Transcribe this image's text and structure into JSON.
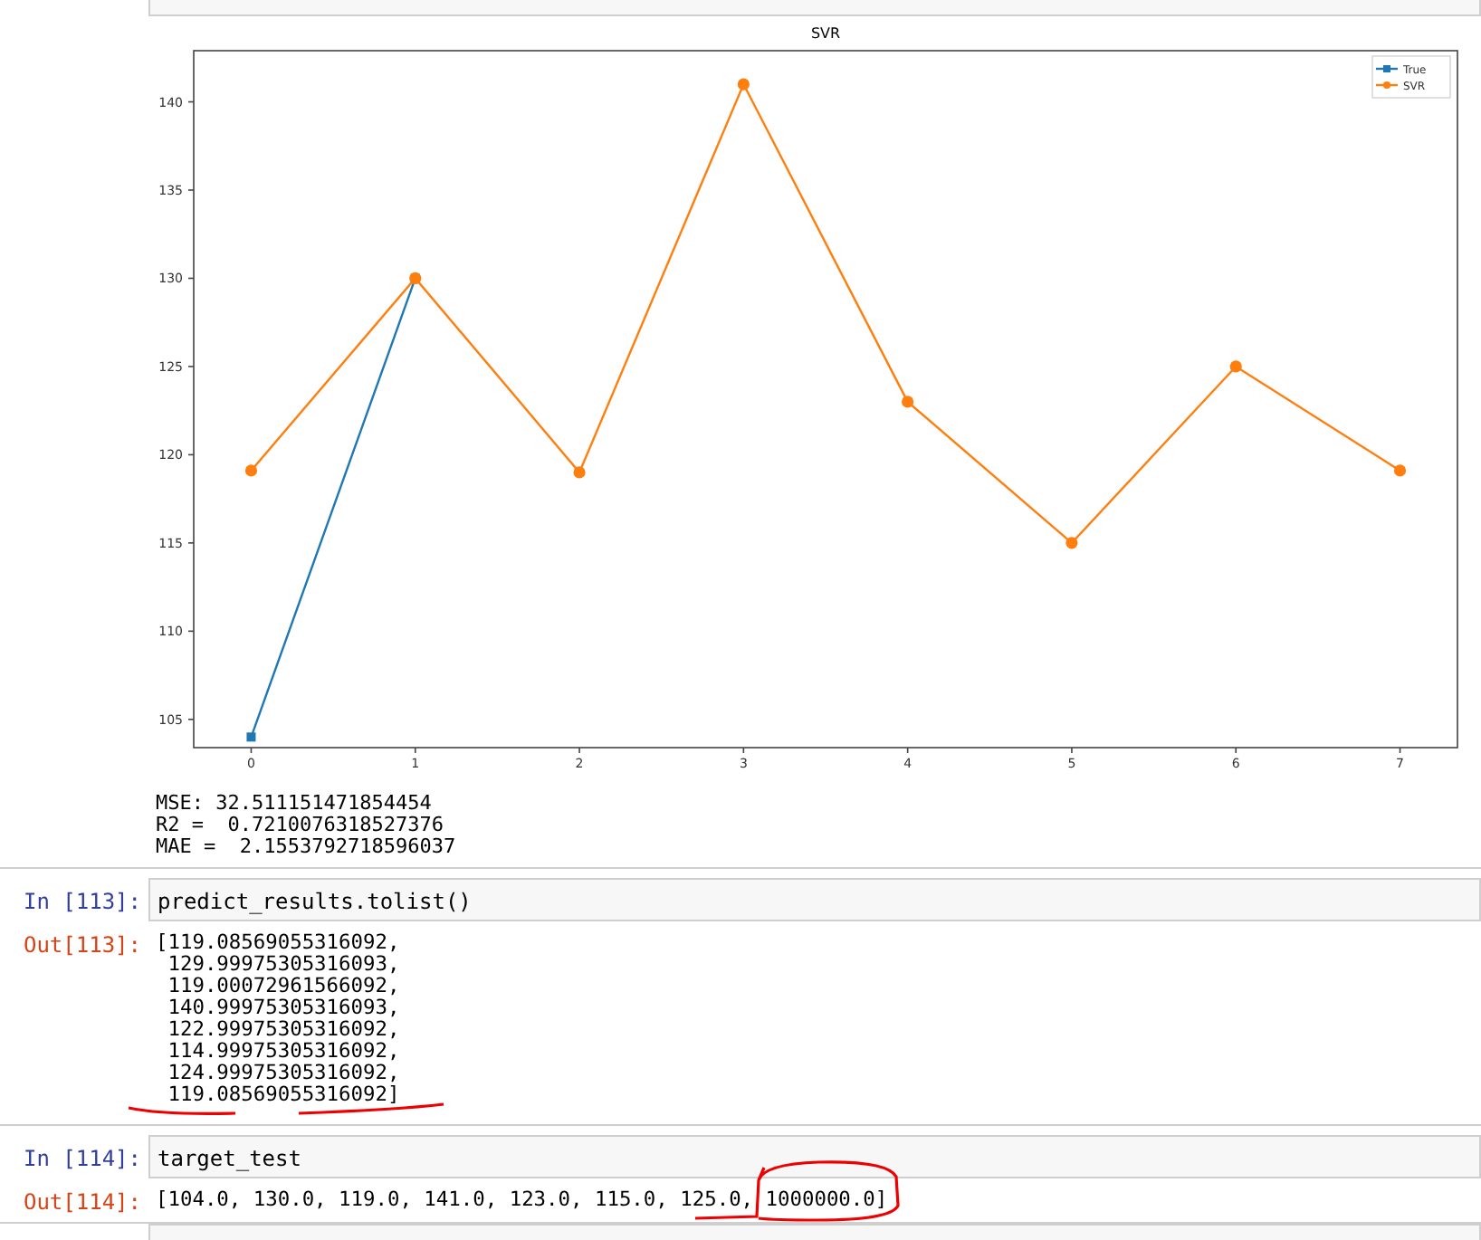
{
  "chart_output": {
    "chart_data": {
      "type": "line",
      "title": "SVR",
      "x": [
        0,
        1,
        2,
        3,
        4,
        5,
        6,
        7
      ],
      "xlim": [
        -0.35,
        7.35
      ],
      "ylim": [
        103.4,
        142.9
      ],
      "legend": true,
      "xticks": [
        0,
        1,
        2,
        3,
        4,
        5,
        6,
        7
      ],
      "yticks": [
        105,
        110,
        115,
        120,
        125,
        130,
        135,
        140
      ],
      "series": [
        {
          "name": "True",
          "color": "#1f77b4",
          "marker": "square",
          "values": [
            104,
            130,
            null,
            null,
            null,
            null,
            null,
            null
          ]
        },
        {
          "name": "SVR",
          "color": "#ff7f0e",
          "marker": "circle",
          "values": [
            119.1,
            130.0,
            119.0,
            141.0,
            123.0,
            115.0,
            125.0,
            119.1
          ]
        }
      ]
    },
    "text_lines": [
      "MSE: 32.511151471854454",
      "R2 =  0.7210076318527376",
      "MAE =  2.1553792718596037"
    ]
  },
  "cells": [
    {
      "prompt_in": "In [113]:",
      "code": "predict_results.tolist()",
      "prompt_out": "Out[113]:",
      "output_lines": [
        "[119.08569055316092,",
        " 129.99975305316093,",
        " 119.00072961566092,",
        " 140.99975305316093,",
        " 122.99975305316092,",
        " 114.99975305316092,",
        " 124.99975305316092,",
        " 119.08569055316092]"
      ],
      "markup": {
        "kind": "underline"
      }
    },
    {
      "prompt_in": "In [114]:",
      "code": "target_test",
      "prompt_out": "Out[114]:",
      "output_lines": [
        "[104.0, 130.0, 119.0, 141.0, 123.0, 115.0, 125.0, 1000000.0]"
      ],
      "markup": {
        "kind": "circle"
      }
    }
  ]
}
